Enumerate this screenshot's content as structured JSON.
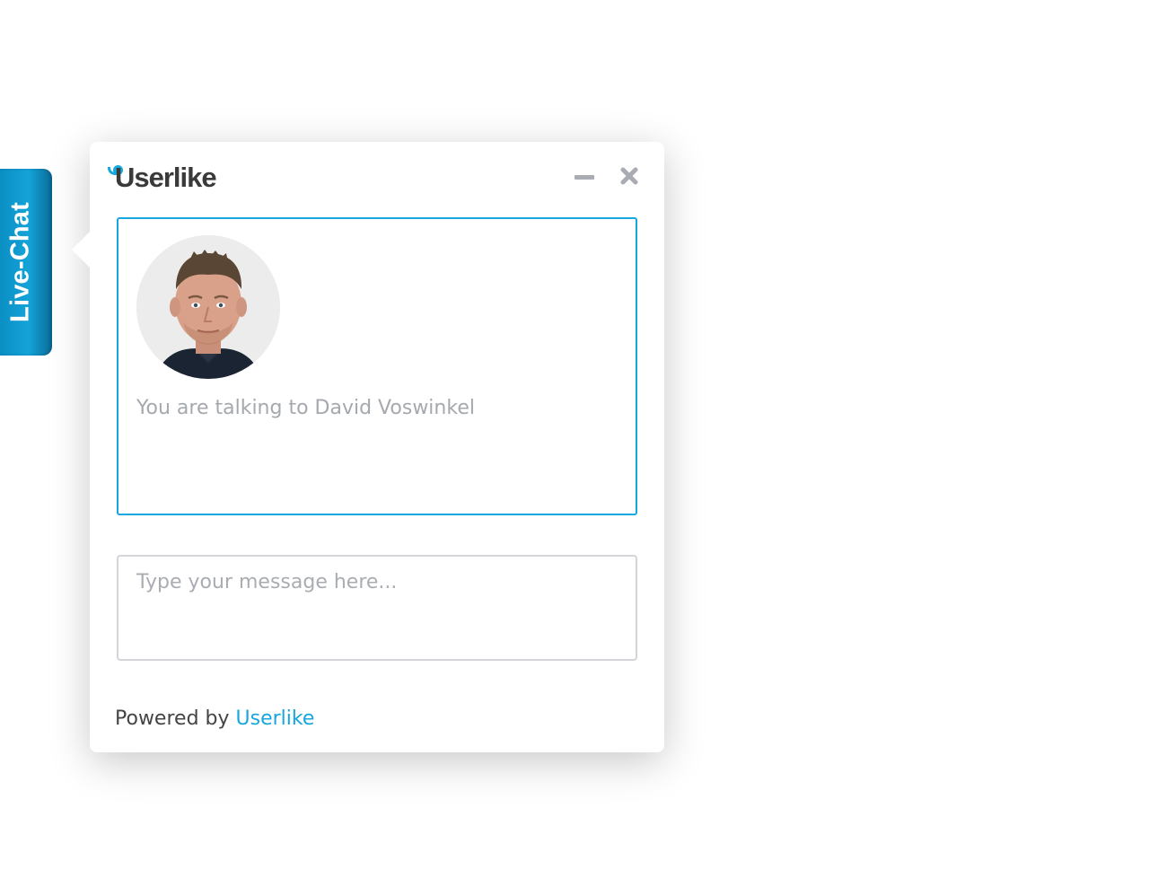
{
  "side_tab": {
    "label": "Live-Chat"
  },
  "header": {
    "brand": "Userlike",
    "minimize_icon": "minus-icon",
    "close_icon": "close-x-icon"
  },
  "conversation": {
    "avatar_alt": "agent-photo",
    "status_text": "You are talking to David Voswinkel"
  },
  "composer": {
    "placeholder": "Type your message here...",
    "value": ""
  },
  "footer": {
    "powered_prefix": "Powered by",
    "powered_link": "Userlike"
  },
  "colors": {
    "accent": "#17a7dd",
    "tab_gradient_start": "#0a8fc4",
    "tab_gradient_end": "#0a6c99",
    "icon_gray": "#a9adb3",
    "placeholder_gray": "#a9adb2",
    "brand_text": "#3a3a3a"
  }
}
